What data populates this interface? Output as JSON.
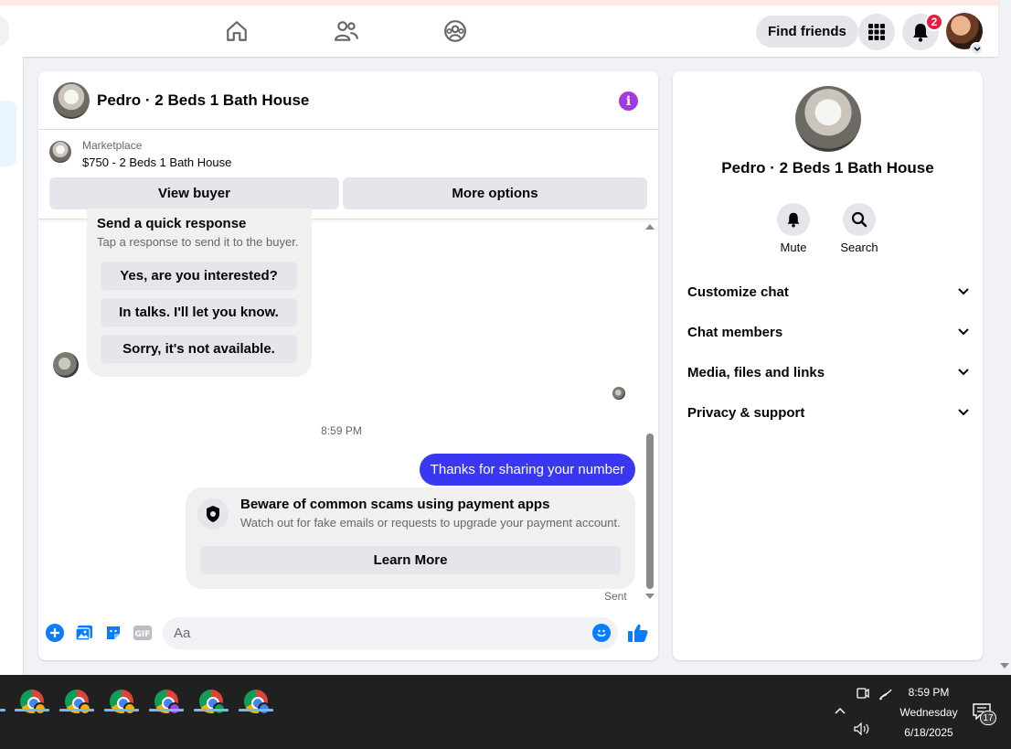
{
  "topbar": {
    "find_friends_label": "Find friends",
    "notification_count": "2",
    "icons": [
      "home-icon",
      "friends-icon",
      "groups-icon",
      "apps-grid-icon",
      "bell-icon"
    ]
  },
  "chat": {
    "title": "Pedro · 2 Beds 1 Bath House",
    "marketplace_label": "Marketplace",
    "listing": "$750 - 2 Beds 1 Bath House",
    "view_buyer_label": "View buyer",
    "more_options_label": "More options",
    "quick_response": {
      "title": "Send a quick response",
      "subtitle": "Tap a response to send it to the buyer.",
      "options": [
        "Yes, are you interested?",
        "In talks. I'll let you know.",
        "Sorry, it's not available."
      ]
    },
    "timestamp": "8:59 PM",
    "my_message": "Thanks for sharing your number",
    "scam_notice": {
      "title": "Beware of common scams using payment apps",
      "subtitle": "Watch out for fake emails or requests to upgrade your payment account.",
      "button": "Learn More"
    },
    "status": "Sent",
    "composer_placeholder": "Aa",
    "gif_label": "GIF"
  },
  "info_panel": {
    "name": "Pedro · 2 Beds 1 Bath House",
    "actions": [
      {
        "label": "Mute",
        "icon": "bell-icon"
      },
      {
        "label": "Search",
        "icon": "search-icon"
      }
    ],
    "sections": [
      "Customize chat",
      "Chat members",
      "Media, files and links",
      "Privacy & support"
    ]
  },
  "taskbar": {
    "time": "8:59 PM",
    "day": "Wednesday",
    "date": "6/18/2025",
    "notification_count": "17",
    "chrome_profile_colors": [
      "#f4b400",
      "#f4b400",
      "#f4b400",
      "#a142f4",
      "#0f9d58",
      "#4285f4"
    ]
  },
  "colors": {
    "accent": "#0a7cff",
    "my_bubble": "#3a37f2",
    "info_button": "#a33ae0",
    "badge": "#e41e3f"
  }
}
